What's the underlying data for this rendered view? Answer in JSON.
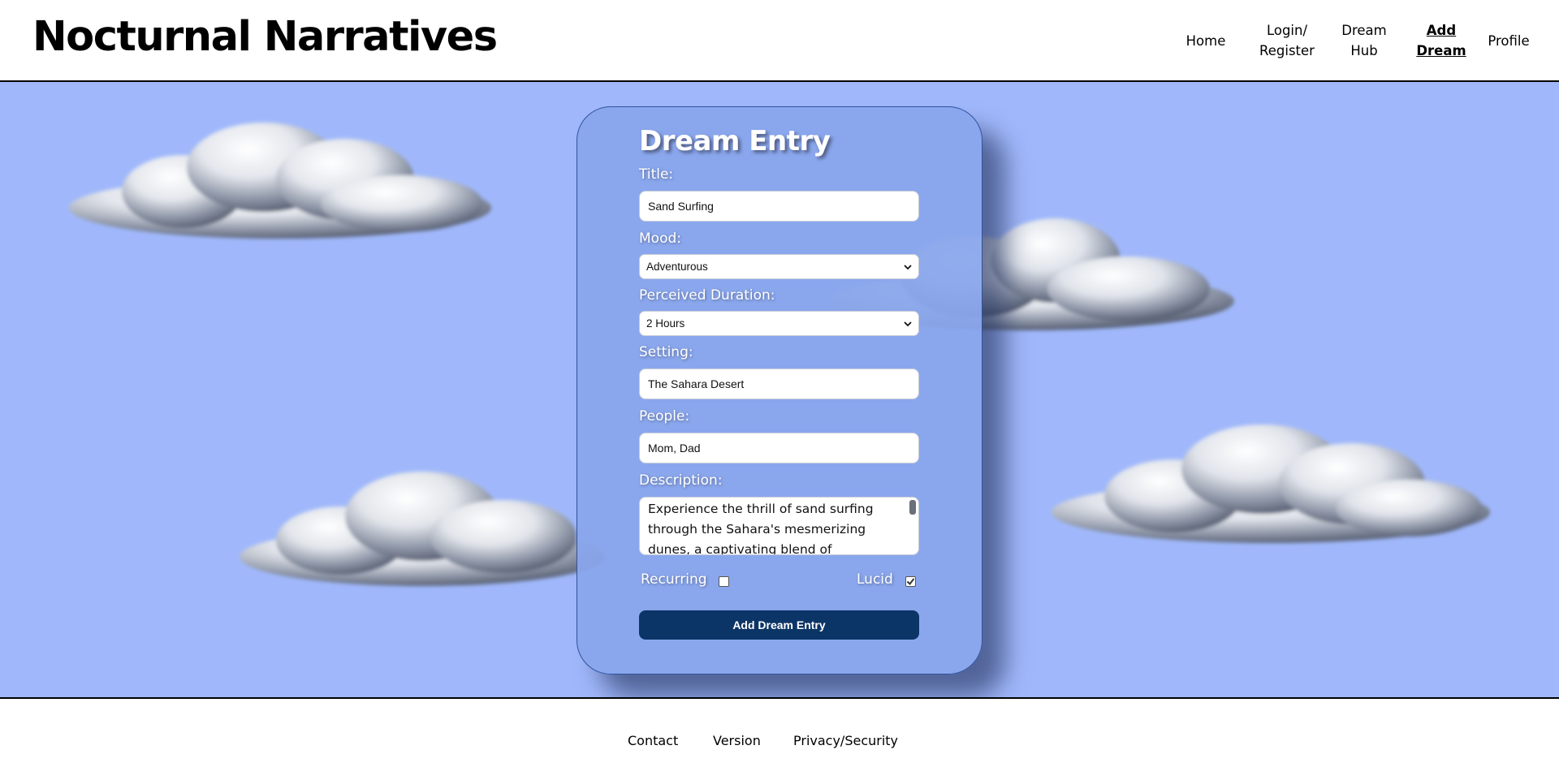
{
  "header": {
    "logo": "Nocturnal Narratives",
    "nav": [
      {
        "label": "Home",
        "active": false
      },
      {
        "label": "Login/\nRegister",
        "active": false
      },
      {
        "label": "Dream\nHub",
        "active": false
      },
      {
        "label": "Add\nDream",
        "active": true
      },
      {
        "label": "Profile",
        "active": false
      }
    ]
  },
  "form": {
    "heading": "Dream Entry",
    "title_label": "Title:",
    "title_value": "Sand Surfing",
    "mood_label": "Mood:",
    "mood_value": "Adventurous",
    "duration_label": "Perceived Duration:",
    "duration_value": "2 Hours",
    "setting_label": "Setting:",
    "setting_value": "The Sahara Desert",
    "people_label": "People:",
    "people_value": "Mom, Dad",
    "description_label": "Description:",
    "description_value": "Experience the thrill of sand surfing through the Sahara's mesmerizing dunes, a captivating blend of",
    "recurring_label": "Recurring",
    "recurring_checked": false,
    "lucid_label": "Lucid",
    "lucid_checked": true,
    "submit_label": "Add Dream Entry"
  },
  "footer": {
    "links": [
      "Contact",
      "Version",
      "Privacy/Security"
    ]
  },
  "colors": {
    "sky": "#a0b8fb",
    "card": "#89a6ec",
    "button": "#0c3567"
  }
}
